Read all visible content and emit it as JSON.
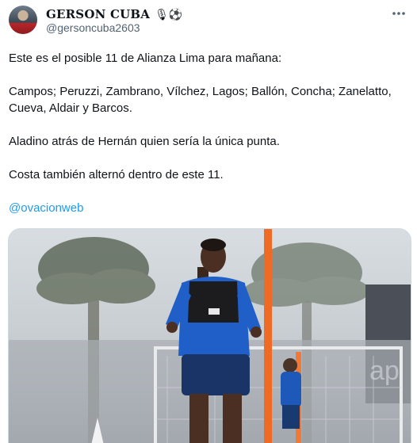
{
  "user": {
    "display_name": "GERSON CUBA",
    "emojis": "🎙⚽",
    "handle": "@gersoncuba2603"
  },
  "tweet": {
    "lines": [
      "Este es el posible 11 de Alianza Lima para mañana:",
      "Campos; Peruzzi, Zambrano, Vílchez, Lagos; Ballón, Concha; Zanelatto, Cueva, Aldair y Barcos.",
      "Aladino atrás de Hernán quien sería la única punta.",
      "Costa también alternó dentro de este 11."
    ],
    "mention": "@ovacionweb"
  },
  "icons": {
    "more": "more-horizontal-icon",
    "avatar": "avatar"
  },
  "colors": {
    "text": "#0f1419",
    "secondary": "#536471",
    "link": "#1d9bf0",
    "border": "#cfd9de",
    "jersey": "#1f5fc7"
  }
}
